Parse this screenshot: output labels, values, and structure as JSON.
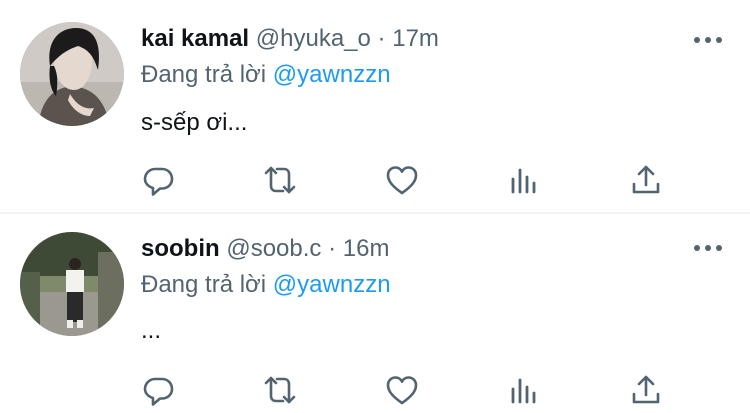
{
  "tweets": [
    {
      "name": "kai kamal",
      "handle": "@hyuka_o",
      "separator": "·",
      "time": "17m",
      "reply_prefix": "Đang trả lời",
      "reply_to": "@yawnzzn",
      "text": "s-sếp ơi..."
    },
    {
      "name": "soobin",
      "handle": "@soob.c",
      "separator": "·",
      "time": "16m",
      "reply_prefix": "Đang trả lời",
      "reply_to": "@yawnzzn",
      "text": "..."
    }
  ],
  "colors": {
    "text_primary": "#0f1419",
    "text_secondary": "#536471",
    "link": "#1d9bf0",
    "divider": "#eff3f4"
  },
  "icons": [
    "more-icon",
    "reply-icon",
    "retweet-icon",
    "like-icon",
    "views-icon",
    "share-icon"
  ]
}
